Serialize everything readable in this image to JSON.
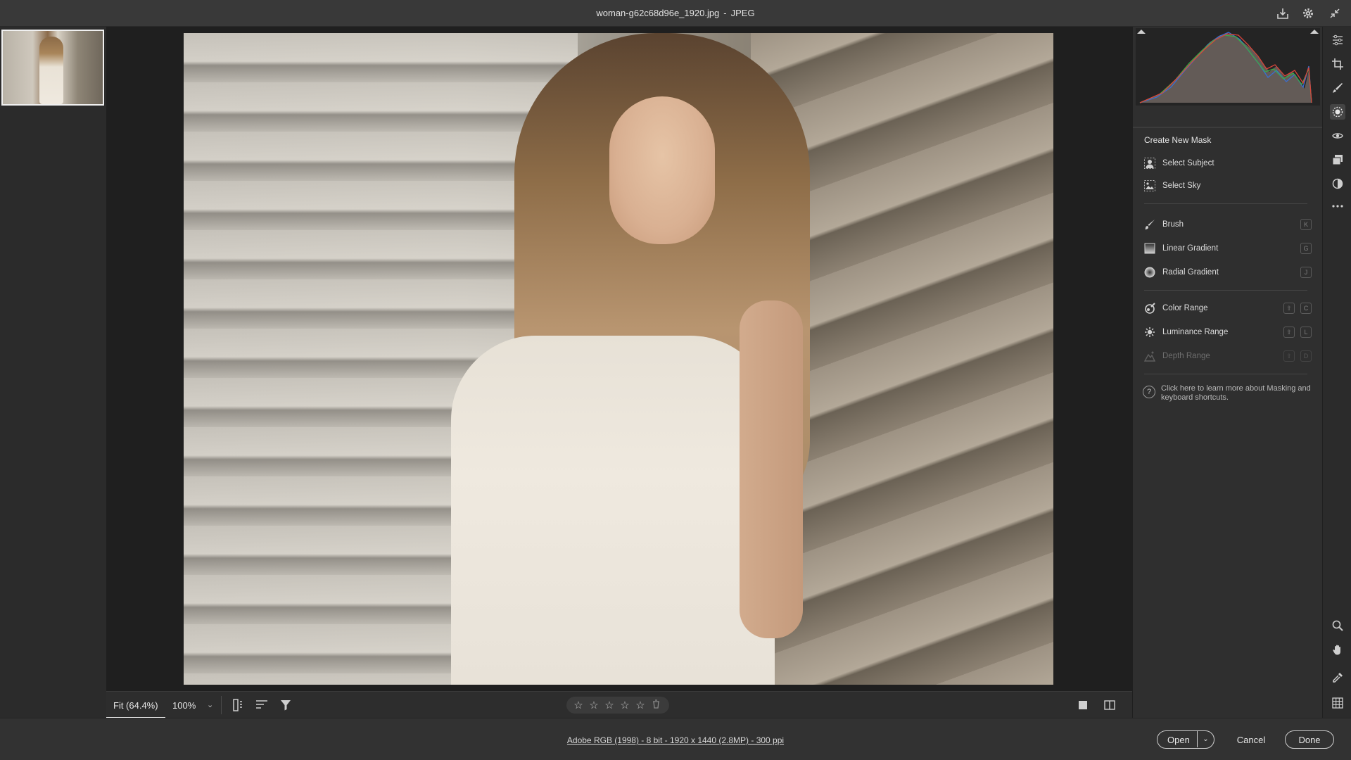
{
  "window": {
    "filename": "woman-g62c68d96e_1920.jpg",
    "separator": "-",
    "format": "JPEG"
  },
  "canvas_bar": {
    "zoom_fit": "Fit (64.4%)",
    "zoom_100": "100%",
    "rating_stars": [
      "☆",
      "☆",
      "☆",
      "☆",
      "☆"
    ],
    "trash_icon": "trash-icon"
  },
  "mask_panel": {
    "title": "Create New Mask",
    "ai_items": [
      {
        "label": "Select Subject",
        "icon": "person-icon"
      },
      {
        "label": "Select Sky",
        "icon": "sky-icon"
      }
    ],
    "tool_items": [
      {
        "label": "Brush",
        "key": "K",
        "icon": "brush-icon"
      },
      {
        "label": "Linear Gradient",
        "key": "G",
        "icon": "linear-gradient-icon"
      },
      {
        "label": "Radial Gradient",
        "key": "J",
        "icon": "radial-gradient-icon"
      }
    ],
    "range_items": [
      {
        "label": "Color Range",
        "keys": [
          "⇧",
          "C"
        ],
        "icon": "color-range-icon",
        "disabled": false
      },
      {
        "label": "Luminance Range",
        "keys": [
          "⇧",
          "L"
        ],
        "icon": "luminance-range-icon",
        "disabled": false
      },
      {
        "label": "Depth Range",
        "keys": [
          "⇧",
          "D"
        ],
        "icon": "depth-range-icon",
        "disabled": true
      }
    ],
    "help_text": "Click here to learn more about Masking and keyboard shortcuts."
  },
  "footer": {
    "file_info": "Adobe RGB (1998) - 8 bit - 1920 x 1440 (2.8MP) - 300 ppi",
    "open_label": "Open",
    "cancel_label": "Cancel",
    "done_label": "Done"
  }
}
